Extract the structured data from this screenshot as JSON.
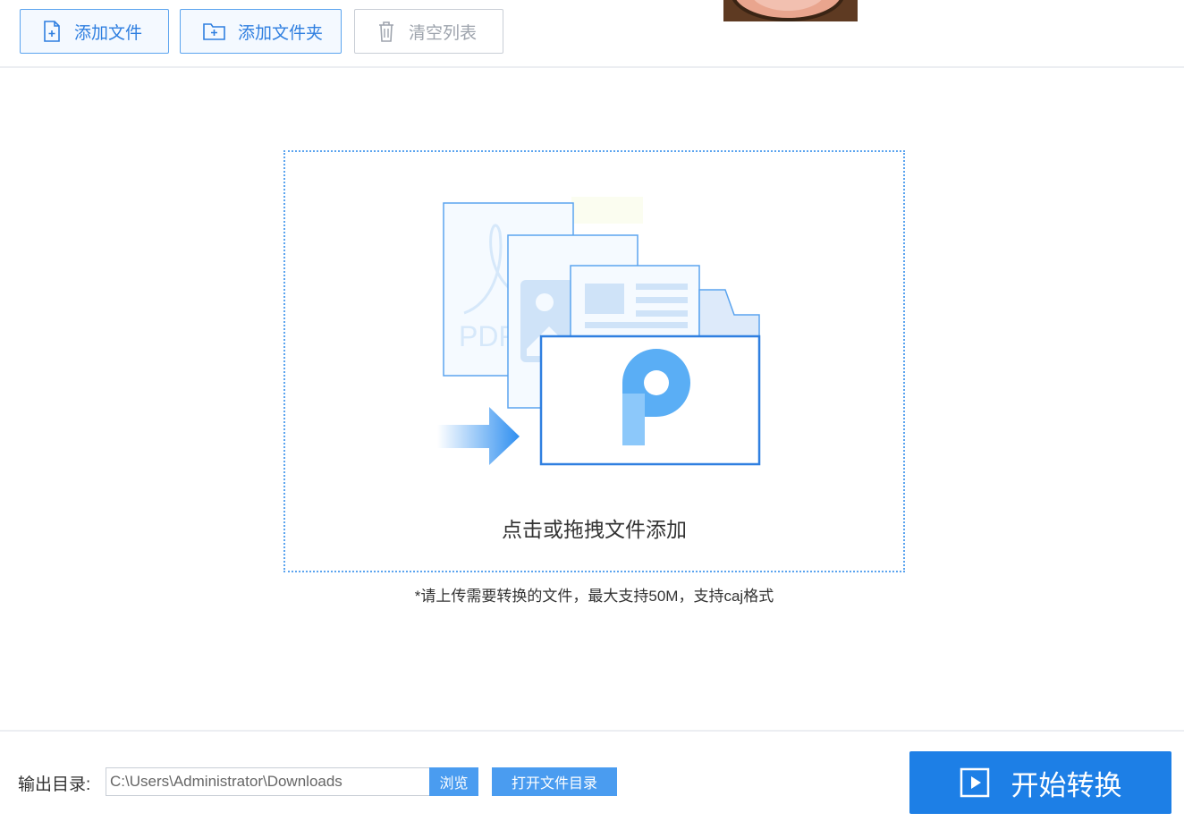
{
  "toolbar": {
    "add_file_label": "添加文件",
    "add_folder_label": "添加文件夹",
    "clear_list_label": "清空列表"
  },
  "dropzone": {
    "text": "点击或拖拽文件添加",
    "illustration_pdf_text": "PDF"
  },
  "hint": "*请上传需要转换的文件，最大支持50M，支持caj格式",
  "output": {
    "label": "输出目录:",
    "path": "C:\\Users\\Administrator\\Downloads",
    "browse_label": "浏览",
    "open_folder_label": "打开文件目录"
  },
  "start_button_label": "开始转换",
  "colors": {
    "accent": "#1d7fe6",
    "border_blue": "#5ba4ef",
    "disabled": "#9ea4ad"
  }
}
